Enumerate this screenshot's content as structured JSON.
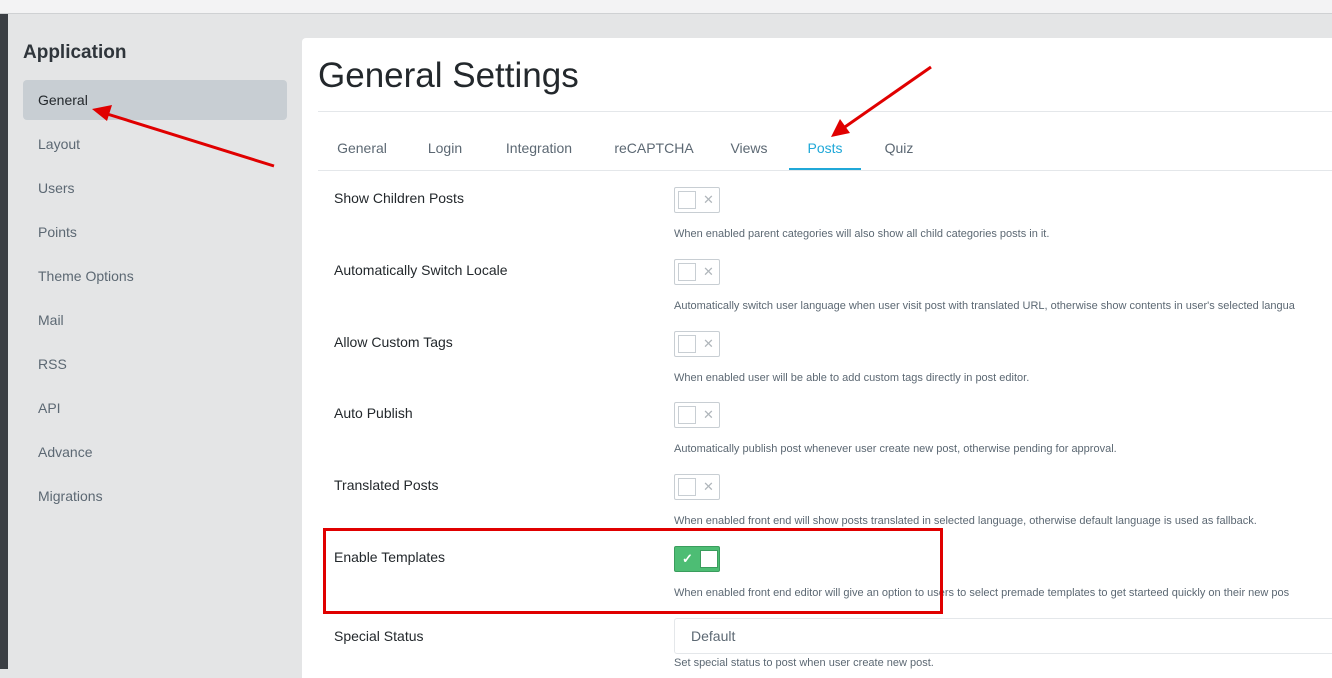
{
  "sidebar": {
    "title": "Application",
    "items": [
      {
        "label": "General",
        "active": true
      },
      {
        "label": "Layout"
      },
      {
        "label": "Users"
      },
      {
        "label": "Points"
      },
      {
        "label": "Theme Options"
      },
      {
        "label": "Mail"
      },
      {
        "label": "RSS"
      },
      {
        "label": "API"
      },
      {
        "label": "Advance"
      },
      {
        "label": "Migrations"
      }
    ]
  },
  "main": {
    "title": "General Settings",
    "tabs": [
      "General",
      "Login",
      "Integration",
      "reCAPTCHA",
      "Views",
      "Posts",
      "Quiz"
    ],
    "active_tab": "Posts",
    "settings": [
      {
        "label": "Show Children Posts",
        "enabled": false,
        "help": "When enabled parent categories will also show all child categories posts in it."
      },
      {
        "label": "Automatically Switch Locale",
        "enabled": false,
        "help": "Automatically switch user language when user visit post with translated URL, otherwise show contents in user's selected langua"
      },
      {
        "label": "Allow Custom Tags",
        "enabled": false,
        "help": "When enabled user will be able to add custom tags directly in post editor."
      },
      {
        "label": "Auto Publish",
        "enabled": false,
        "help": "Automatically publish post whenever user create new post, otherwise pending for approval."
      },
      {
        "label": "Translated Posts",
        "enabled": false,
        "help": "When enabled front end will show posts translated in selected language, otherwise default language is used as fallback."
      },
      {
        "label": "Enable Templates",
        "enabled": true,
        "help": "When enabled front end editor will give an option to users to select premade templates to get starteed quickly on their new pos"
      }
    ],
    "special_status": {
      "label": "Special Status",
      "value": "Default",
      "help": "Set special status to post when user create new post."
    }
  },
  "icons": {
    "toggle_off": "✕",
    "toggle_on": "✓"
  },
  "colors": {
    "accent": "#20a8d8",
    "toggle_on": "#4dbd74",
    "annotation": "#e00000"
  }
}
